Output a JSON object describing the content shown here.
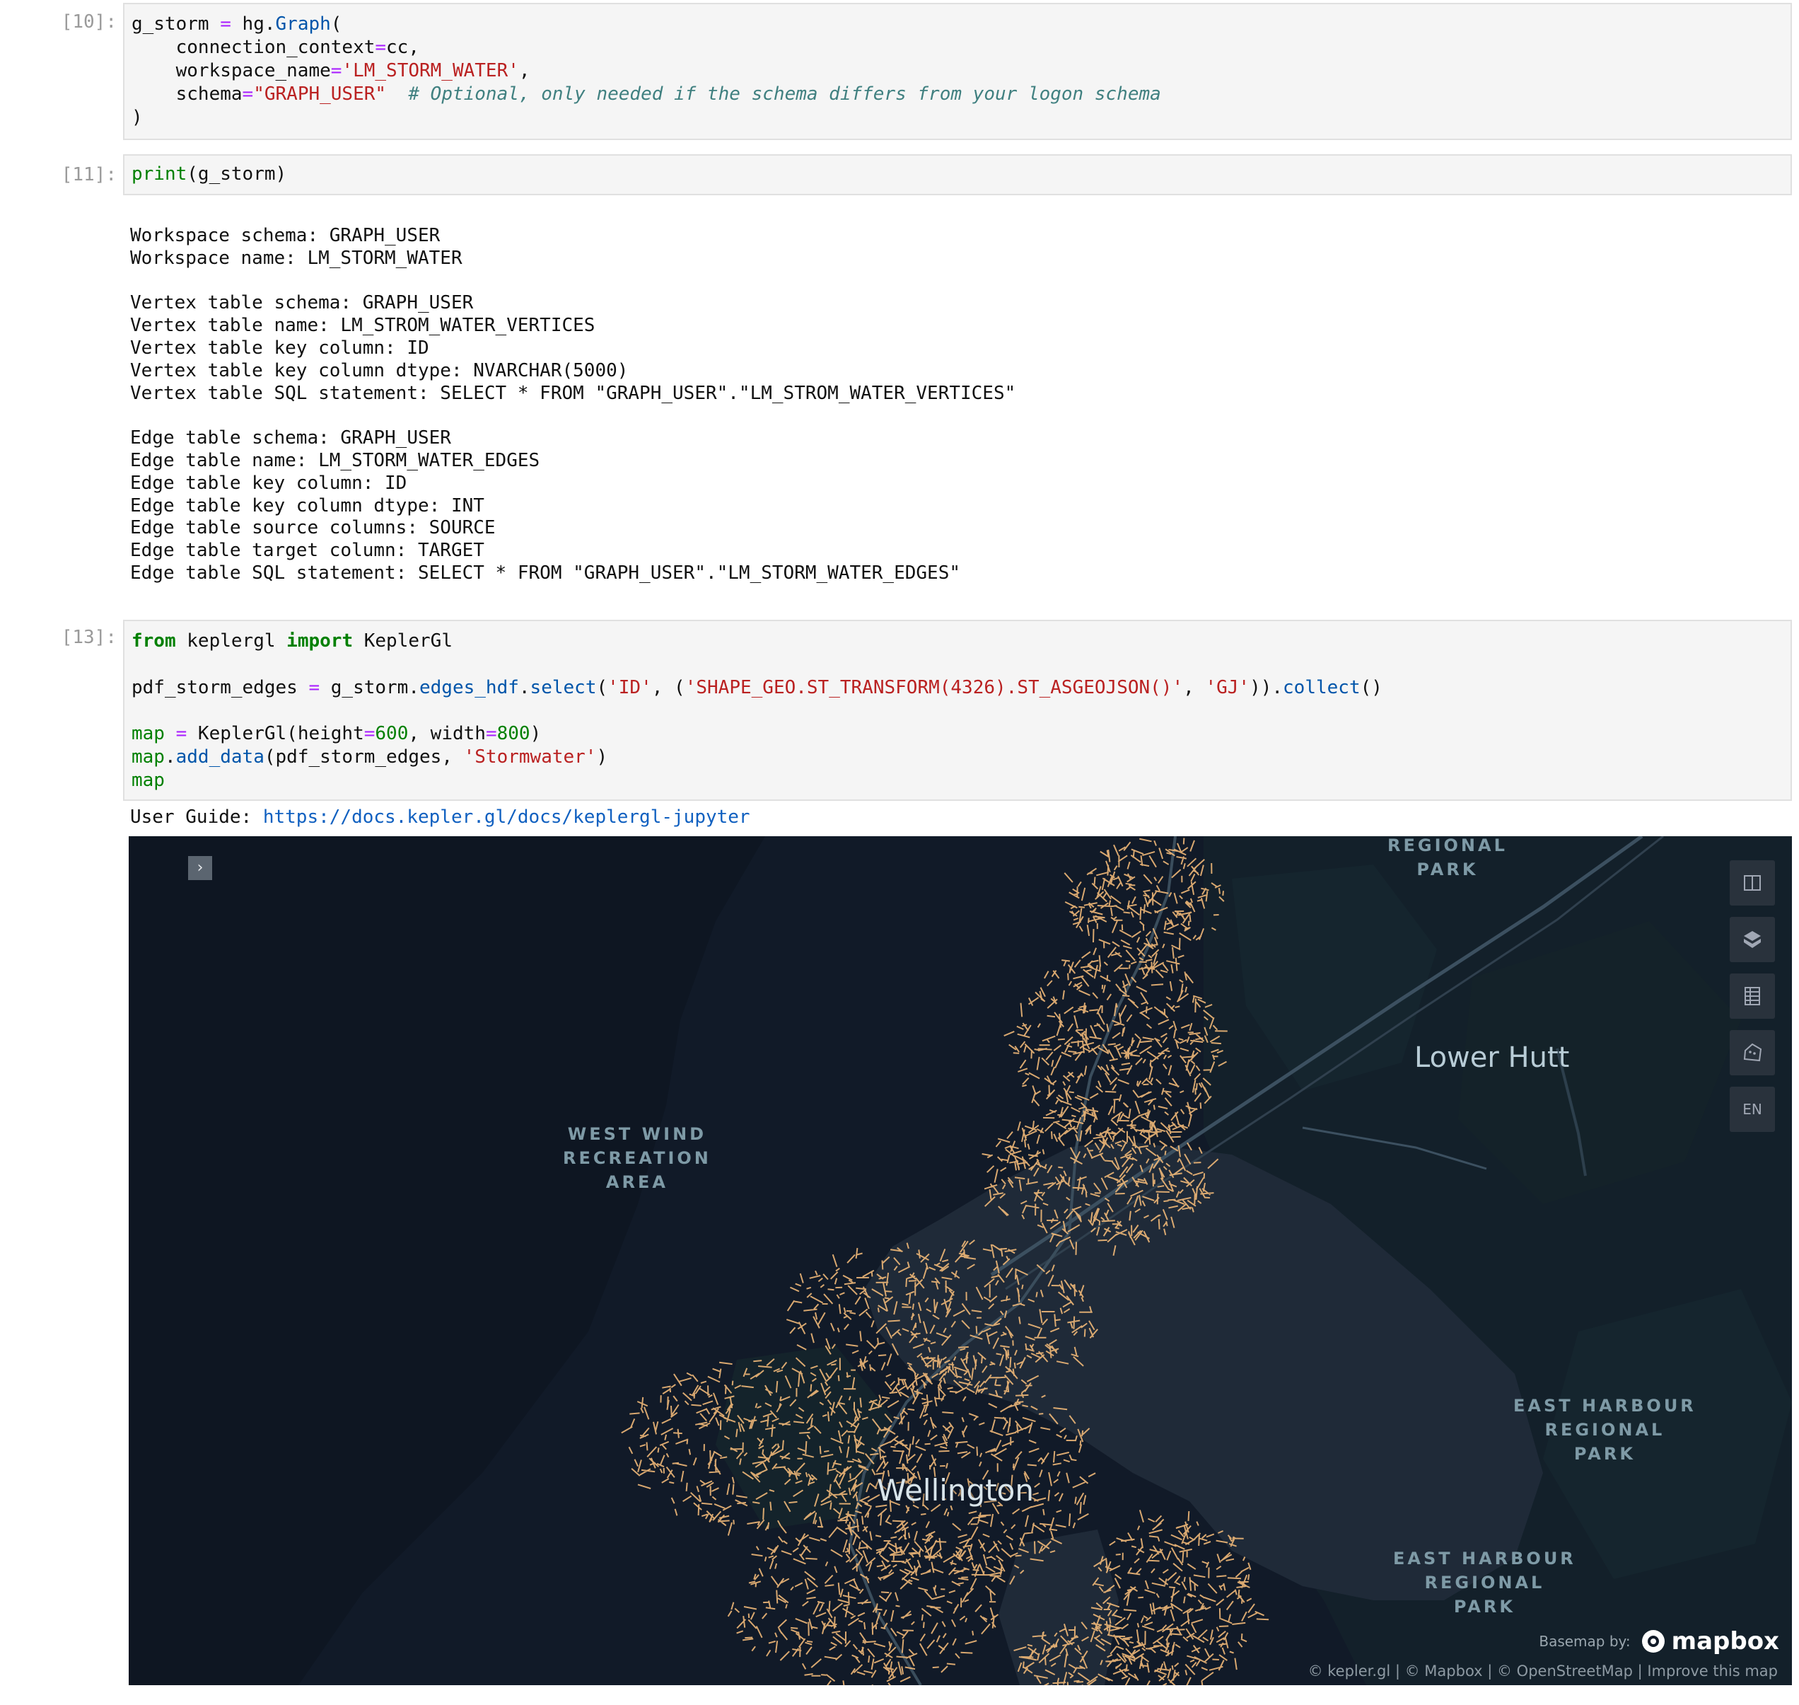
{
  "cells": {
    "c10": {
      "prompt": "[10]:",
      "l1_a": "g_storm ",
      "l1_op": "=",
      "l1_b": " hg.",
      "l1_fn": "Graph",
      "l1_c": "(",
      "l2_a": "    connection_context",
      "l2_op": "=",
      "l2_b": "cc,",
      "l3_a": "    workspace_name",
      "l3_op": "=",
      "l3_str": "'LM_STORM_WATER'",
      "l3_b": ",",
      "l4_a": "    schema",
      "l4_op": "=",
      "l4_str": "\"GRAPH_USER\"",
      "l4_cm": "  # Optional, only needed if the schema differs from your logon schema",
      "l5": ")"
    },
    "c11": {
      "prompt": "[11]:",
      "fn": "print",
      "args": "(g_storm)",
      "output": "Workspace schema: GRAPH_USER\nWorkspace name: LM_STORM_WATER\n\nVertex table schema: GRAPH_USER\nVertex table name: LM_STROM_WATER_VERTICES\nVertex table key column: ID\nVertex table key column dtype: NVARCHAR(5000)\nVertex table SQL statement: SELECT * FROM \"GRAPH_USER\".\"LM_STROM_WATER_VERTICES\"\n\nEdge table schema: GRAPH_USER\nEdge table name: LM_STORM_WATER_EDGES\nEdge table key column: ID\nEdge table key column dtype: INT\nEdge table source columns: SOURCE\nEdge table target column: TARGET\nEdge table SQL statement: SELECT * FROM \"GRAPH_USER\".\"LM_STORM_WATER_EDGES\""
    },
    "c13": {
      "prompt": "[13]:",
      "l1_kw1": "from",
      "l1_a": " keplergl ",
      "l1_kw2": "import",
      "l1_b": " KeplerGl",
      "l2_a": "pdf_storm_edges ",
      "l2_op": "=",
      "l2_b": " g_storm.",
      "l2_fn1": "edges_hdf",
      "l2_c": ".",
      "l2_fn2": "select",
      "l2_d": "(",
      "l2_s1": "'ID'",
      "l2_e": ", (",
      "l2_s2": "'SHAPE_GEO.ST_TRANSFORM(4326).ST_ASGEOJSON()'",
      "l2_f": ", ",
      "l2_s3": "'GJ'",
      "l2_g": ")).",
      "l2_fn3": "collect",
      "l2_h": "()",
      "l3_kw": "map",
      "l3_op1": " =",
      "l3_a": " KeplerGl(height",
      "l3_op2": "=",
      "l3_n1": "600",
      "l3_b": ", width",
      "l3_op3": "=",
      "l3_n2": "800",
      "l3_c": ")",
      "l4_kw": "map",
      "l4_a": ".",
      "l4_fn": "add_data",
      "l4_b": "(pdf_storm_edges, ",
      "l4_str": "'Stormwater'",
      "l4_c": ")",
      "l5_kw": "map",
      "guide_label": "User Guide: ",
      "guide_link": "https://docs.kepler.gl/docs/keplergl-jupyter"
    }
  },
  "map": {
    "labels": {
      "regional_park_top": "REGIONAL\nPARK",
      "west_wind": "WEST WIND\nRECREATION\nAREA",
      "east_harbour_1": "EAST HARBOUR\nREGIONAL\nPARK",
      "east_harbour_2": "EAST HARBOUR\nREGIONAL\nPARK",
      "lower_hutt": "Lower Hutt",
      "wellington": "Wellington"
    },
    "controls": {
      "split": "split-map-icon",
      "view3d": "3d-map-icon",
      "table": "data-table-icon",
      "draw": "draw-polygon-icon",
      "locale": "EN"
    },
    "basemap_label": "Basemap by:",
    "mapbox": "mapbox",
    "attribution": "© kepler.gl | © Mapbox | © OpenStreetMap | Improve this map",
    "colors": {
      "background": "#111a28",
      "water": "#1f2a38",
      "edges": "#f0b878"
    }
  }
}
